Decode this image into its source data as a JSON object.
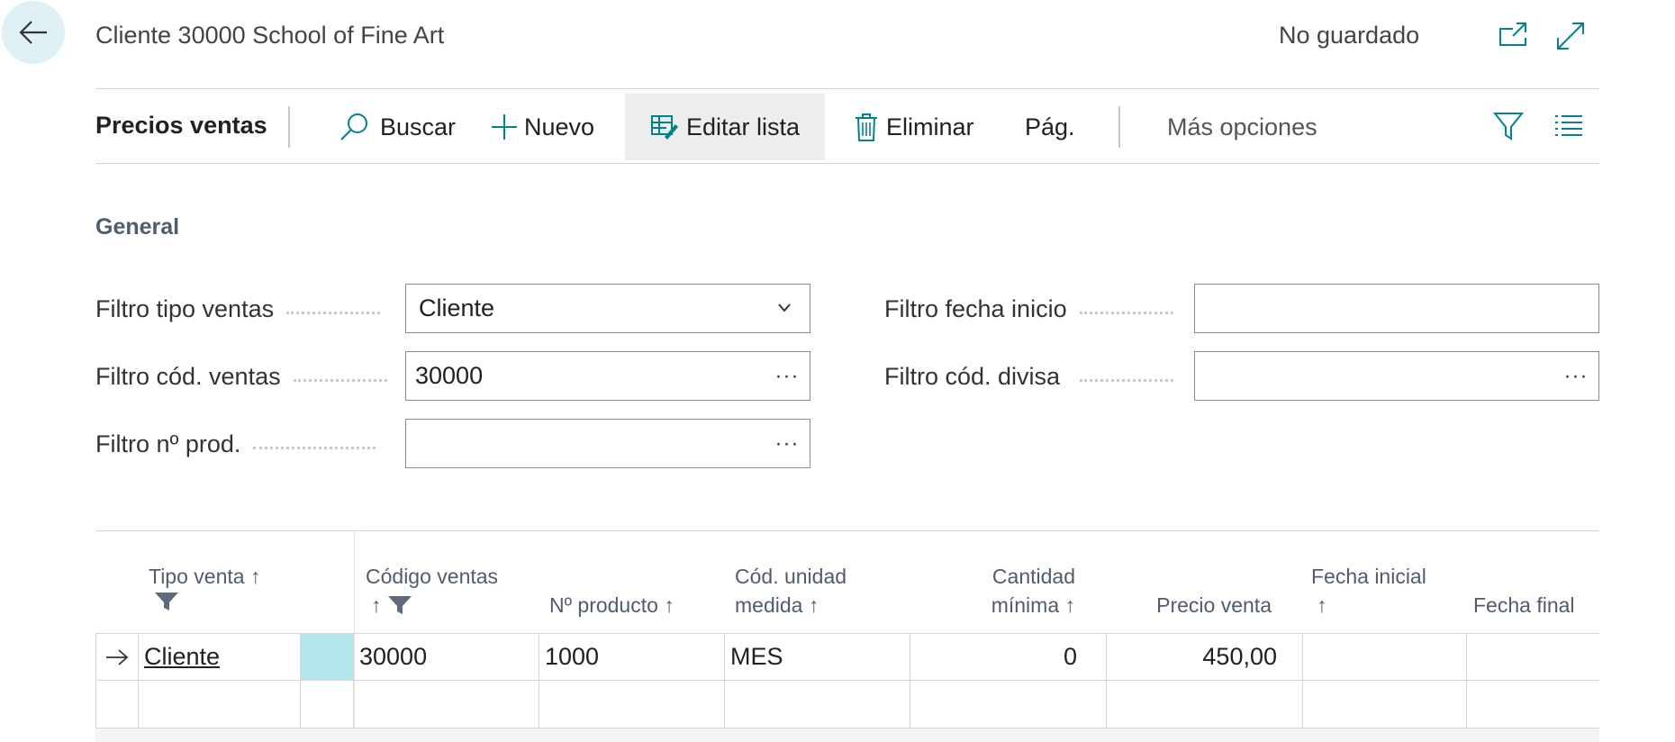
{
  "header": {
    "title": "Cliente 30000 School of Fine Art",
    "status": "No guardado"
  },
  "actionbar": {
    "tab": "Precios ventas",
    "actions": {
      "search": "Buscar",
      "new": "Nuevo",
      "edit_list": "Editar lista",
      "delete": "Eliminar",
      "page": "Pág.",
      "more": "Más opciones"
    }
  },
  "general": {
    "title": "General",
    "fields": {
      "sales_type_filter": {
        "label": "Filtro tipo ventas",
        "value": "Cliente"
      },
      "sales_code_filter": {
        "label": "Filtro cód. ventas",
        "value": "30000"
      },
      "item_no_filter": {
        "label": "Filtro nº prod.",
        "value": ""
      },
      "start_date_filter": {
        "label": "Filtro fecha inicio",
        "value": ""
      },
      "currency_filter": {
        "label": "Filtro cód. divisa",
        "value": ""
      }
    },
    "ellipsis": "···"
  },
  "table": {
    "headers": {
      "sales_type_l1": "Tipo venta ↑",
      "sales_code_l1": "Código ventas",
      "sales_code_l2": "↑",
      "item_no": "Nº producto ↑",
      "uom_l1": "Cód. unidad",
      "uom_l2": "medida ↑",
      "min_qty_l1": "Cantidad",
      "min_qty_l2": "mínima ↑",
      "unit_price": "Precio venta",
      "start_date_l1": "Fecha inicial",
      "start_date_l2": "↑",
      "end_date": "Fecha final"
    },
    "rows": [
      {
        "sales_type": "Cliente",
        "sales_code": "30000",
        "item_no": "1000",
        "uom": "MES",
        "min_qty": "0",
        "unit_price": "450,00",
        "start_date": "",
        "end_date": ""
      }
    ]
  },
  "colors": {
    "accent": "#00838f",
    "highlight": "#b3e5ea",
    "back_bg": "#dff1f4"
  }
}
